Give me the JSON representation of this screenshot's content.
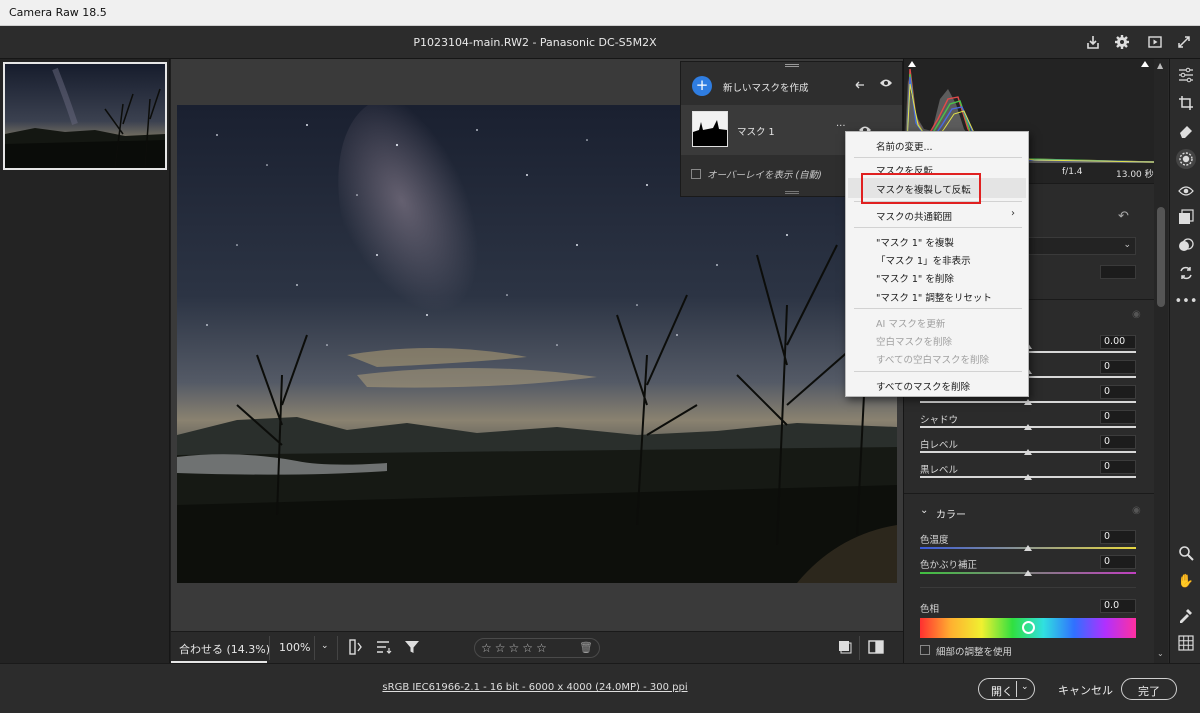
{
  "window": {
    "app_title": "Camera Raw 18.5"
  },
  "document": {
    "title": "P1023104-main.RW2  -  Panasonic DC-S5M2X"
  },
  "toolbar": {
    "icons": [
      "save-icon",
      "gear-icon",
      "slideshow-icon",
      "fullscreen-icon"
    ]
  },
  "histogram": {
    "aperture": "f/1.4",
    "shutter": "13.00 秒"
  },
  "mask_panel": {
    "create_label": "新しいマスクを作成",
    "mask_name": "マスク 1",
    "overlay_label": "オーバーレイを表示 (自動)",
    "overlay_checked": false
  },
  "context_menu": {
    "items": [
      {
        "label": "名前の変更...",
        "enabled": true
      },
      {
        "label": "マスクを反転",
        "enabled": true
      },
      {
        "label": "マスクを複製して反転",
        "enabled": true,
        "highlighted": true
      },
      {
        "label": "マスクの共通範囲",
        "enabled": true,
        "submenu": true
      },
      {
        "label": "\"マスク 1\" を複製",
        "enabled": true
      },
      {
        "label": "「マスク 1」を非表示",
        "enabled": true
      },
      {
        "label": "\"マスク 1\" を削除",
        "enabled": true
      },
      {
        "label": "\"マスク 1\" 調整をリセット",
        "enabled": true
      },
      {
        "label": "AI マスクを更新",
        "enabled": false
      },
      {
        "label": "空白マスクを削除",
        "enabled": false
      },
      {
        "label": "すべての空白マスクを削除",
        "enabled": false
      },
      {
        "label": "すべてのマスクを削除",
        "enabled": true
      }
    ]
  },
  "light_section": {
    "sliders": [
      {
        "label": "",
        "value": "0.00",
        "position": 0.5
      },
      {
        "label": "",
        "value": "0",
        "position": 0.5
      },
      {
        "label": "",
        "value": "0",
        "position": 0.5
      },
      {
        "label": "シャドウ",
        "value": "0",
        "position": 0.5
      },
      {
        "label": "白レベル",
        "value": "0",
        "position": 0.5
      },
      {
        "label": "黒レベル",
        "value": "0",
        "position": 0.5
      }
    ]
  },
  "color_section": {
    "title": "カラー",
    "sliders": [
      {
        "label": "色温度",
        "value": "0",
        "position": 0.5
      },
      {
        "label": "色かぶり補正",
        "value": "0",
        "position": 0.5
      }
    ],
    "hue_label": "色相",
    "hue_value": "0.0",
    "fine_adjust_label": "細部の調整を使用",
    "fine_adjust_checked": false
  },
  "bottom_bar": {
    "zoom_fit": "合わせる (14.3%)",
    "zoom_percent": "100%",
    "star_rating": 0,
    "stars": [
      "☆",
      "☆",
      "☆",
      "☆",
      "☆"
    ]
  },
  "footer": {
    "workflow_info": "sRGB IEC61966-2.1 - 16 bit - 6000 x 4000 (24.0MP) - 300 ppi",
    "open_label": "開く",
    "cancel_label": "キャンセル",
    "done_label": "完了"
  },
  "colors": {
    "accent_blue": "#2f7de1",
    "highlight_red": "#e02020"
  }
}
